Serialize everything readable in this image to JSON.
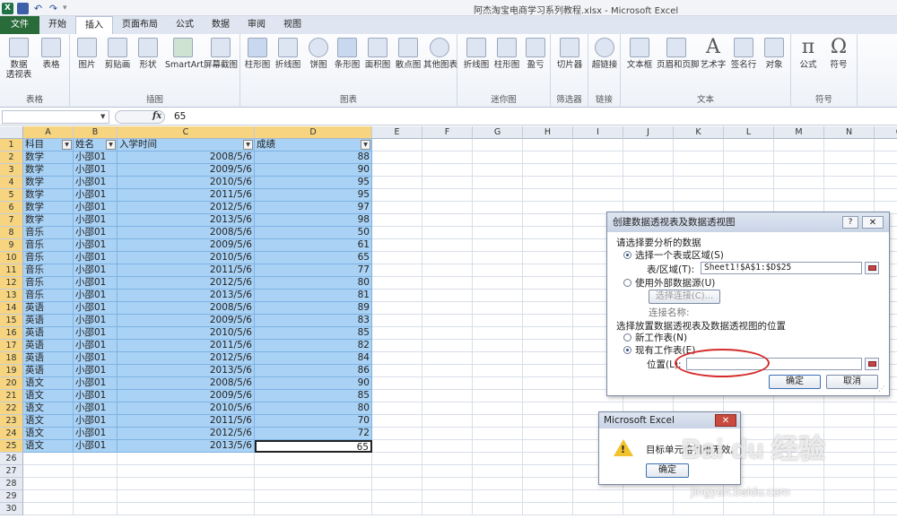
{
  "window": {
    "title": "阿杰淘宝电商学习系列教程.xlsx - Microsoft Excel",
    "qat_undo": "↶",
    "qat_redo": "↷",
    "qat_more": "▾"
  },
  "tabs": [
    "文件",
    "开始",
    "插入",
    "页面布局",
    "公式",
    "数据",
    "审阅",
    "视图"
  ],
  "ribbon": {
    "groups": [
      {
        "label": "表格",
        "buttons": [
          "数据\n透视表",
          "表格"
        ]
      },
      {
        "label": "插图",
        "buttons": [
          "图片",
          "剪贴画",
          "形状",
          "SmartArt",
          "屏幕截图"
        ]
      },
      {
        "label": "图表",
        "buttons": [
          "柱形图",
          "折线图",
          "饼图",
          "条形图",
          "面积图",
          "散点图",
          "其他图表"
        ]
      },
      {
        "label": "迷你图",
        "buttons": [
          "折线图",
          "柱形图",
          "盈亏"
        ]
      },
      {
        "label": "筛选器",
        "buttons": [
          "切片器"
        ]
      },
      {
        "label": "链接",
        "buttons": [
          "超链接"
        ]
      },
      {
        "label": "文本",
        "buttons": [
          "文本框",
          "页眉和页脚",
          "艺术字",
          "签名行",
          "对象"
        ]
      },
      {
        "label": "符号",
        "buttons": [
          "公式",
          "符号"
        ]
      }
    ],
    "glyphs": {
      "formula": "π",
      "symbol": "Ω",
      "wordart": "A"
    }
  },
  "formula_bar": {
    "name_box": "",
    "fx": "fx",
    "value": "65"
  },
  "grid": {
    "columns": [
      "A",
      "B",
      "C",
      "D",
      "E",
      "F",
      "G",
      "H",
      "I",
      "J",
      "K",
      "L",
      "M",
      "N",
      "O"
    ],
    "header_row": [
      "科目",
      "姓名",
      "入学时间",
      "成绩"
    ],
    "rows": [
      [
        "数学",
        "小邵01",
        "2008/5/6",
        "88"
      ],
      [
        "数学",
        "小邵01",
        "2009/5/6",
        "90"
      ],
      [
        "数学",
        "小邵01",
        "2010/5/6",
        "95"
      ],
      [
        "数学",
        "小邵01",
        "2011/5/6",
        "95"
      ],
      [
        "数学",
        "小邵01",
        "2012/5/6",
        "97"
      ],
      [
        "数学",
        "小邵01",
        "2013/5/6",
        "98"
      ],
      [
        "音乐",
        "小邵01",
        "2008/5/6",
        "50"
      ],
      [
        "音乐",
        "小邵01",
        "2009/5/6",
        "61"
      ],
      [
        "音乐",
        "小邵01",
        "2010/5/6",
        "65"
      ],
      [
        "音乐",
        "小邵01",
        "2011/5/6",
        "77"
      ],
      [
        "音乐",
        "小邵01",
        "2012/5/6",
        "80"
      ],
      [
        "音乐",
        "小邵01",
        "2013/5/6",
        "81"
      ],
      [
        "英语",
        "小邵01",
        "2008/5/6",
        "89"
      ],
      [
        "英语",
        "小邵01",
        "2009/5/6",
        "83"
      ],
      [
        "英语",
        "小邵01",
        "2010/5/6",
        "85"
      ],
      [
        "英语",
        "小邵01",
        "2011/5/6",
        "82"
      ],
      [
        "英语",
        "小邵01",
        "2012/5/6",
        "84"
      ],
      [
        "英语",
        "小邵01",
        "2013/5/6",
        "86"
      ],
      [
        "语文",
        "小邵01",
        "2008/5/6",
        "90"
      ],
      [
        "语文",
        "小邵01",
        "2009/5/6",
        "85"
      ],
      [
        "语文",
        "小邵01",
        "2010/5/6",
        "80"
      ],
      [
        "语文",
        "小邵01",
        "2011/5/6",
        "70"
      ],
      [
        "语文",
        "小邵01",
        "2012/5/6",
        "72"
      ],
      [
        "语文",
        "小邵01",
        "2013/5/6",
        "65"
      ]
    ],
    "row_numbers": [
      "1",
      "2",
      "3",
      "4",
      "5",
      "6",
      "7",
      "8",
      "9",
      "10",
      "11",
      "12",
      "13",
      "14",
      "15",
      "16",
      "17",
      "18",
      "19",
      "20",
      "21",
      "22",
      "23",
      "24",
      "25",
      "26",
      "27",
      "28",
      "29",
      "30"
    ]
  },
  "pivot_dialog": {
    "title": "创建数据透视表及数据透视图",
    "help": "?",
    "close": "✕",
    "section1": "请选择要分析的数据",
    "opt_table": "选择一个表或区域(S)",
    "range_label": "表/区域(T):",
    "range_value": "Sheet1!$A$1:$D$25",
    "opt_external": "使用外部数据源(U)",
    "choose_conn": "选择连接(C)...",
    "conn_name": "连接名称:",
    "section2": "选择放置数据透视表及数据透视图的位置",
    "opt_new": "新工作表(N)",
    "opt_existing": "现有工作表(E)",
    "location_label": "位置(L):",
    "location_value": "",
    "ok": "确定",
    "cancel": "取消"
  },
  "message_box": {
    "title": "Microsoft Excel",
    "close": "✕",
    "text": "目标单元格引用无效。",
    "ok": "确定"
  },
  "watermark": {
    "text": "Bai du 经验",
    "url": "jingyan.baidu.com"
  }
}
